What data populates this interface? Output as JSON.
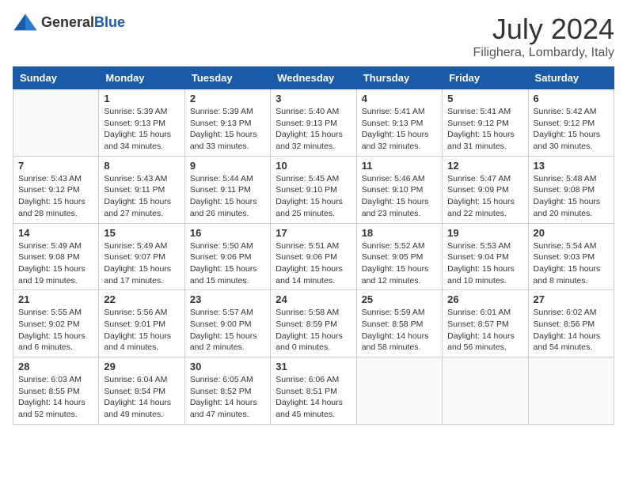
{
  "header": {
    "logo_general": "General",
    "logo_blue": "Blue",
    "month_title": "July 2024",
    "location": "Filighera, Lombardy, Italy"
  },
  "weekdays": [
    "Sunday",
    "Monday",
    "Tuesday",
    "Wednesday",
    "Thursday",
    "Friday",
    "Saturday"
  ],
  "weeks": [
    [
      {
        "day": "",
        "info": ""
      },
      {
        "day": "1",
        "info": "Sunrise: 5:39 AM\nSunset: 9:13 PM\nDaylight: 15 hours\nand 34 minutes."
      },
      {
        "day": "2",
        "info": "Sunrise: 5:39 AM\nSunset: 9:13 PM\nDaylight: 15 hours\nand 33 minutes."
      },
      {
        "day": "3",
        "info": "Sunrise: 5:40 AM\nSunset: 9:13 PM\nDaylight: 15 hours\nand 32 minutes."
      },
      {
        "day": "4",
        "info": "Sunrise: 5:41 AM\nSunset: 9:13 PM\nDaylight: 15 hours\nand 32 minutes."
      },
      {
        "day": "5",
        "info": "Sunrise: 5:41 AM\nSunset: 9:12 PM\nDaylight: 15 hours\nand 31 minutes."
      },
      {
        "day": "6",
        "info": "Sunrise: 5:42 AM\nSunset: 9:12 PM\nDaylight: 15 hours\nand 30 minutes."
      }
    ],
    [
      {
        "day": "7",
        "info": "Sunrise: 5:43 AM\nSunset: 9:12 PM\nDaylight: 15 hours\nand 28 minutes."
      },
      {
        "day": "8",
        "info": "Sunrise: 5:43 AM\nSunset: 9:11 PM\nDaylight: 15 hours\nand 27 minutes."
      },
      {
        "day": "9",
        "info": "Sunrise: 5:44 AM\nSunset: 9:11 PM\nDaylight: 15 hours\nand 26 minutes."
      },
      {
        "day": "10",
        "info": "Sunrise: 5:45 AM\nSunset: 9:10 PM\nDaylight: 15 hours\nand 25 minutes."
      },
      {
        "day": "11",
        "info": "Sunrise: 5:46 AM\nSunset: 9:10 PM\nDaylight: 15 hours\nand 23 minutes."
      },
      {
        "day": "12",
        "info": "Sunrise: 5:47 AM\nSunset: 9:09 PM\nDaylight: 15 hours\nand 22 minutes."
      },
      {
        "day": "13",
        "info": "Sunrise: 5:48 AM\nSunset: 9:08 PM\nDaylight: 15 hours\nand 20 minutes."
      }
    ],
    [
      {
        "day": "14",
        "info": "Sunrise: 5:49 AM\nSunset: 9:08 PM\nDaylight: 15 hours\nand 19 minutes."
      },
      {
        "day": "15",
        "info": "Sunrise: 5:49 AM\nSunset: 9:07 PM\nDaylight: 15 hours\nand 17 minutes."
      },
      {
        "day": "16",
        "info": "Sunrise: 5:50 AM\nSunset: 9:06 PM\nDaylight: 15 hours\nand 15 minutes."
      },
      {
        "day": "17",
        "info": "Sunrise: 5:51 AM\nSunset: 9:06 PM\nDaylight: 15 hours\nand 14 minutes."
      },
      {
        "day": "18",
        "info": "Sunrise: 5:52 AM\nSunset: 9:05 PM\nDaylight: 15 hours\nand 12 minutes."
      },
      {
        "day": "19",
        "info": "Sunrise: 5:53 AM\nSunset: 9:04 PM\nDaylight: 15 hours\nand 10 minutes."
      },
      {
        "day": "20",
        "info": "Sunrise: 5:54 AM\nSunset: 9:03 PM\nDaylight: 15 hours\nand 8 minutes."
      }
    ],
    [
      {
        "day": "21",
        "info": "Sunrise: 5:55 AM\nSunset: 9:02 PM\nDaylight: 15 hours\nand 6 minutes."
      },
      {
        "day": "22",
        "info": "Sunrise: 5:56 AM\nSunset: 9:01 PM\nDaylight: 15 hours\nand 4 minutes."
      },
      {
        "day": "23",
        "info": "Sunrise: 5:57 AM\nSunset: 9:00 PM\nDaylight: 15 hours\nand 2 minutes."
      },
      {
        "day": "24",
        "info": "Sunrise: 5:58 AM\nSunset: 8:59 PM\nDaylight: 15 hours\nand 0 minutes."
      },
      {
        "day": "25",
        "info": "Sunrise: 5:59 AM\nSunset: 8:58 PM\nDaylight: 14 hours\nand 58 minutes."
      },
      {
        "day": "26",
        "info": "Sunrise: 6:01 AM\nSunset: 8:57 PM\nDaylight: 14 hours\nand 56 minutes."
      },
      {
        "day": "27",
        "info": "Sunrise: 6:02 AM\nSunset: 8:56 PM\nDaylight: 14 hours\nand 54 minutes."
      }
    ],
    [
      {
        "day": "28",
        "info": "Sunrise: 6:03 AM\nSunset: 8:55 PM\nDaylight: 14 hours\nand 52 minutes."
      },
      {
        "day": "29",
        "info": "Sunrise: 6:04 AM\nSunset: 8:54 PM\nDaylight: 14 hours\nand 49 minutes."
      },
      {
        "day": "30",
        "info": "Sunrise: 6:05 AM\nSunset: 8:52 PM\nDaylight: 14 hours\nand 47 minutes."
      },
      {
        "day": "31",
        "info": "Sunrise: 6:06 AM\nSunset: 8:51 PM\nDaylight: 14 hours\nand 45 minutes."
      },
      {
        "day": "",
        "info": ""
      },
      {
        "day": "",
        "info": ""
      },
      {
        "day": "",
        "info": ""
      }
    ]
  ]
}
